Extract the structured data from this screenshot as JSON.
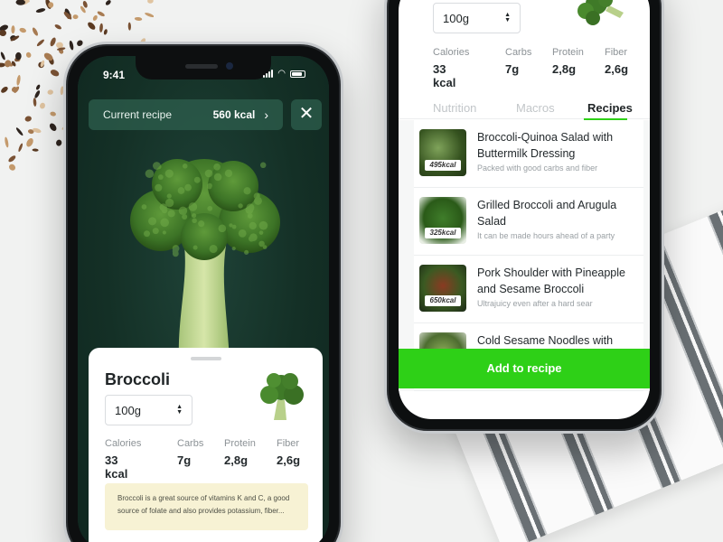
{
  "colors": {
    "accent": "#2ed017",
    "card_bg": "#ffffff",
    "note_bg": "#f7f2d4",
    "dark_green": "#17342b"
  },
  "left_phone": {
    "status_time": "9:41",
    "current_recipe": {
      "label": "Current recipe",
      "kcal": "560 kcal",
      "chevron_icon": "chevron-right-icon"
    },
    "close_icon": "close-icon",
    "food": {
      "name": "Broccoli",
      "quantity": "100g",
      "nutrition": [
        {
          "label": "Calories",
          "value": "33 kcal"
        },
        {
          "label": "Carbs",
          "value": "7g"
        },
        {
          "label": "Protein",
          "value": "2,8g"
        },
        {
          "label": "Fiber",
          "value": "2,6g"
        }
      ],
      "note": "Broccoli is a great source of vitamins K and C, a good source of folate and also provides potassium, fiber..."
    }
  },
  "right_phone": {
    "quantity": "100g",
    "nutrition": [
      {
        "label": "Calories",
        "value": "33 kcal"
      },
      {
        "label": "Carbs",
        "value": "7g"
      },
      {
        "label": "Protein",
        "value": "2,8g"
      },
      {
        "label": "Fiber",
        "value": "2,6g"
      }
    ],
    "tabs": [
      "Nutrition",
      "Macros",
      "Recipes"
    ],
    "active_tab": "Recipes",
    "recipes": [
      {
        "title": "Broccoli-Quinoa Salad with Buttermilk Dressing",
        "description": "Packed with good carbs and fiber",
        "kcal": "495kcal"
      },
      {
        "title": "Grilled Broccoli and Arugula Salad",
        "description": "It can be made hours ahead of a party",
        "kcal": "325kcal"
      },
      {
        "title": "Pork Shoulder with Pineapple and Sesame Broccoli",
        "description": "Ultrajuicy even after a hard sear",
        "kcal": "650kcal"
      },
      {
        "title": "Cold Sesame Noodles with Broccoli and Kale",
        "description": "",
        "kcal": ""
      }
    ],
    "add_button": "Add to recipe"
  }
}
